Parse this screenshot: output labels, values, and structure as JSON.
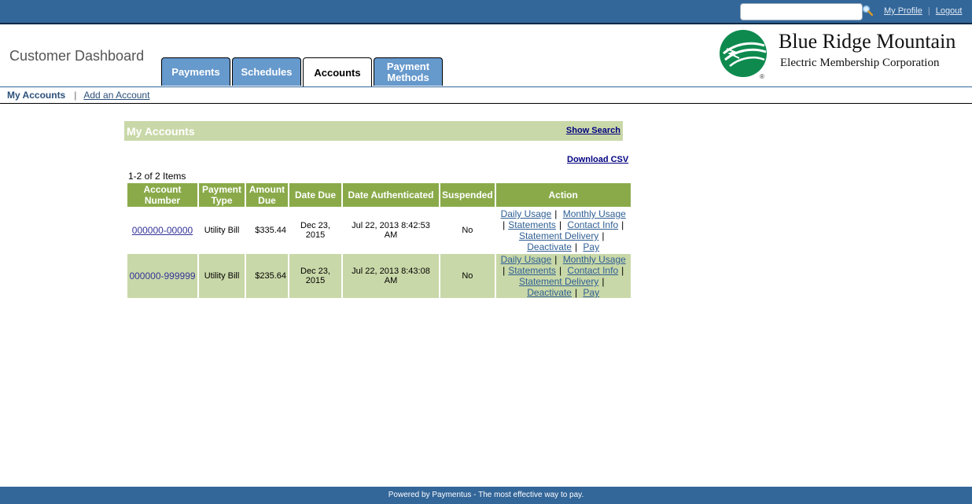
{
  "topbar": {
    "search_placeholder": "",
    "search_value": "",
    "links": [
      "My Profile",
      "Logout"
    ],
    "separator": "|"
  },
  "header": {
    "title": "Customer Dashboard",
    "tabs": [
      {
        "label": "Payments",
        "active": false
      },
      {
        "label": "Schedules",
        "active": false
      },
      {
        "label": "Accounts",
        "active": true
      },
      {
        "label": "Payment Methods",
        "active": false
      }
    ],
    "logo": {
      "name": "Blue Ridge Mountain",
      "subtitle": "Electric Membership Corporation",
      "registered": "®",
      "brand_color": "#0e8a4f"
    }
  },
  "subnav": {
    "current": "My Accounts",
    "separator": "|",
    "link": "Add an Account"
  },
  "panel": {
    "title": "My Accounts",
    "show_search": "Show Search",
    "download_csv": "Download CSV",
    "items_count": "1-2 of 2 Items"
  },
  "table": {
    "columns": [
      "Account Number",
      "Payment Type",
      "Amount Due",
      "Date Due",
      "Date Authenticated",
      "Suspended",
      "Action"
    ],
    "rows": [
      {
        "account_number": "000000-00000",
        "payment_type": "Utility Bill",
        "amount_due": "$335.44",
        "date_due": "Dec 23, 2015",
        "date_authenticated": "Jul 22, 2013 8:42:53 AM",
        "suspended": "No",
        "actions": [
          "Daily Usage",
          "Monthly Usage",
          "Statements",
          "Contact Info",
          "Statement Delivery",
          "Deactivate",
          "Pay"
        ]
      },
      {
        "account_number": "000000-999999",
        "payment_type": "Utility Bill",
        "amount_due": "$235.64",
        "date_due": "Dec 23, 2015",
        "date_authenticated": "Jul 22, 2013 8:43:08 AM",
        "suspended": "No",
        "actions": [
          "Daily Usage",
          "Monthly Usage",
          "Statements",
          "Contact Info",
          "Statement Delivery",
          "Deactivate",
          "Pay"
        ]
      }
    ]
  },
  "footer": {
    "text": "Powered by Paymentus - The most effective way to pay."
  },
  "colors": {
    "topbar": "#336699",
    "tab": "#6699cc",
    "table_header": "#8aaa4a",
    "alt_row": "#c9d8a8"
  }
}
